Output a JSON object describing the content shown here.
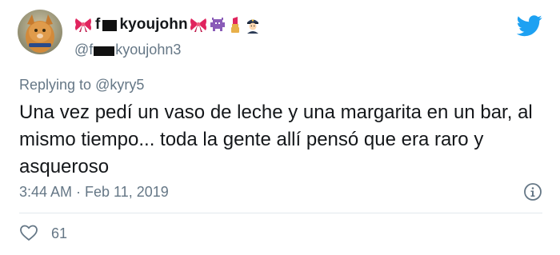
{
  "author": {
    "display_name_prefix": "f",
    "display_name_suffix": "kyoujohn",
    "handle_prefix": "@f",
    "handle_suffix": "kyoujohn3"
  },
  "reply": {
    "prefix": "Replying to ",
    "mention": "@kyry5"
  },
  "tweet": {
    "text": "Una vez pedí un vaso de leche y una margarita en un bar, al mismo tiempo... toda la gente allí pensó que era raro y asqueroso",
    "timestamp": "3:44 AM · Feb 11, 2019"
  },
  "stats": {
    "likes": "61"
  },
  "icons": {
    "brand": "twitter-bird-icon",
    "info": "info-icon",
    "like": "heart-icon",
    "emojis": [
      "ribbon-icon",
      "ribbon-icon",
      "alien-monster-icon",
      "lipstick-icon",
      "police-officer-icon"
    ]
  },
  "colors": {
    "twitter_blue": "#1da1f2",
    "secondary_text": "#657786",
    "primary_text": "#14171a"
  }
}
